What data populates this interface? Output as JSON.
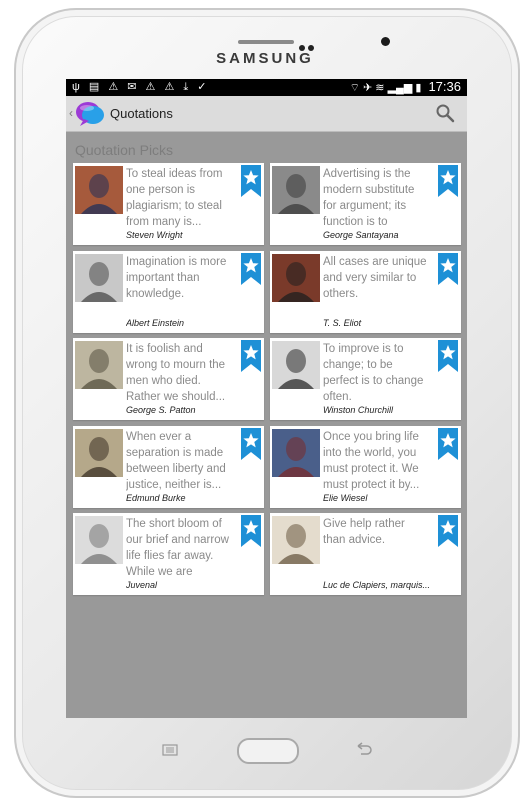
{
  "device": {
    "brand": "SAMSUNG"
  },
  "status_bar": {
    "left_icons": [
      "usb-icon",
      "sim-icon",
      "warning-icon",
      "mail-icon",
      "warning-icon",
      "warning-icon",
      "download-icon",
      "clipboard-icon"
    ],
    "time": "17:36"
  },
  "action_bar": {
    "title": "Quotations"
  },
  "section": {
    "title": "Quotation Picks"
  },
  "quotes": [
    {
      "text": "To steal ideas from one person is plagiarism; to steal from many is...",
      "author": "Steven Wright"
    },
    {
      "text": "Advertising is the modern substitute for argument; its function is to make...",
      "author": "George Santayana"
    },
    {
      "text": "Imagination is more important than knowledge.",
      "author": "Albert Einstein"
    },
    {
      "text": "All cases are unique and very similar to others.",
      "author": "T. S. Eliot"
    },
    {
      "text": "It is foolish and wrong to mourn the men who died. Rather we should...",
      "author": "George S. Patton"
    },
    {
      "text": "To improve is to change; to be perfect is to change often.",
      "author": "Winston Churchill"
    },
    {
      "text": "When ever a separation is made between liberty and justice, neither is...",
      "author": "Edmund Burke"
    },
    {
      "text": "Once you bring life into the world, you must protect it. We must protect it by...",
      "author": "Elie Wiesel"
    },
    {
      "text": "The short bloom of our brief and narrow life flies far away. While we are calling...",
      "author": "Juvenal"
    },
    {
      "text": "Give help rather than advice.",
      "author": "Luc de Clapiers,  marquis..."
    }
  ],
  "colors": {
    "accent": "#1e90d6",
    "background": "#999999",
    "action_bar": "#dcdcdc"
  }
}
